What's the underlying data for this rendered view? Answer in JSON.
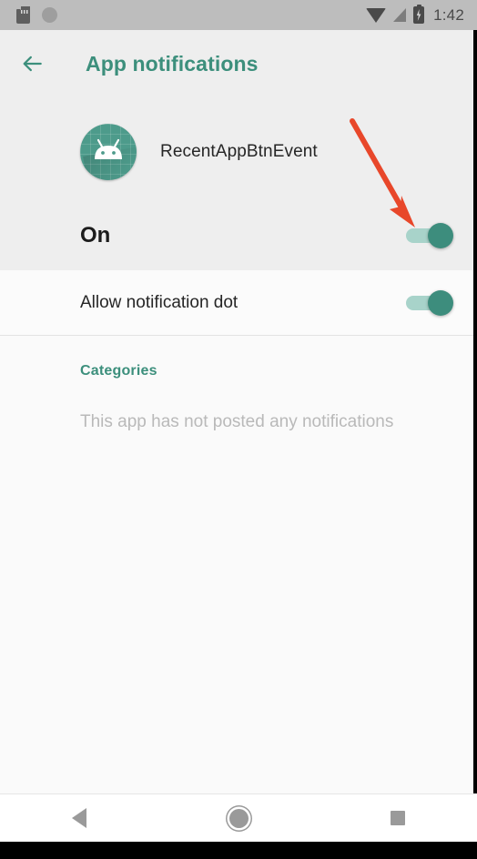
{
  "status_bar": {
    "time": "1:42",
    "icons": [
      "sd-card-icon",
      "circle-icon",
      "wifi-icon",
      "cellular-signal-icon",
      "battery-charging-icon"
    ]
  },
  "app_bar": {
    "back_icon": "back-arrow-icon",
    "title": "App notifications",
    "accent_color": "#3c8f7c"
  },
  "app_header": {
    "icon_name": "android-app-icon",
    "app_name": "RecentAppBtnEvent",
    "master_toggle_label": "On",
    "master_toggle_state": "on"
  },
  "settings_rows": [
    {
      "label": "Allow notification dot",
      "toggle_state": "on"
    }
  ],
  "categories": {
    "title": "Categories",
    "empty_message": "This app has not posted any notifications"
  },
  "annotation": {
    "type": "arrow",
    "color": "#e8472a",
    "target": "master-notification-toggle"
  },
  "nav_bar": {
    "items": [
      {
        "name": "back",
        "icon": "triangle-back-icon"
      },
      {
        "name": "home",
        "icon": "circle-home-icon"
      },
      {
        "name": "recents",
        "icon": "square-recents-icon"
      }
    ]
  },
  "colors": {
    "accent": "#3c8f7c",
    "toggle_thumb": "#3d8d7d",
    "toggle_track": "#a8d3ca",
    "header_bg": "#eeeeee",
    "annotation": "#e8472a"
  }
}
